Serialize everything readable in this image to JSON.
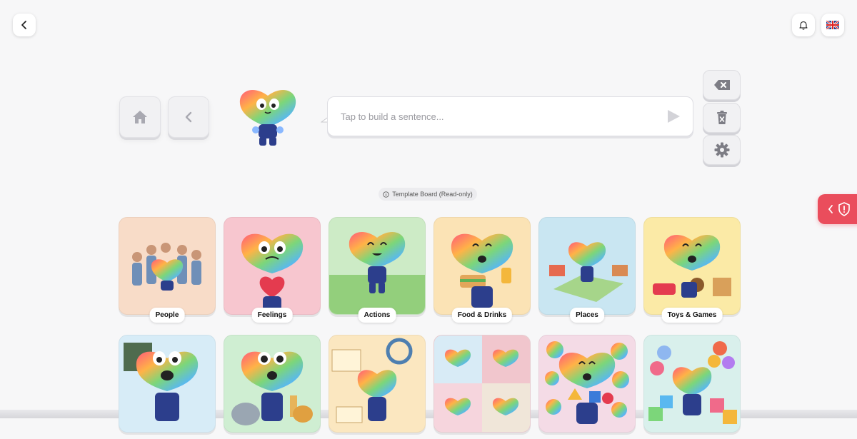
{
  "header": {
    "back_icon": "chevron-left-icon",
    "notifications_icon": "bell-icon",
    "language_icon": "uk-flag-icon"
  },
  "nav": {
    "home_icon": "home-icon",
    "back_icon": "chevron-left-icon"
  },
  "sentence": {
    "placeholder": "Tap to build a sentence...",
    "play_icon": "play-icon"
  },
  "side_controls": {
    "backspace_icon": "backspace-icon",
    "clear_icon": "trash-x-icon",
    "settings_icon": "gear-icon"
  },
  "board": {
    "badge_text": "Template Board (Read-only)",
    "badge_icon": "info-icon"
  },
  "safety_tab": {
    "icon_chevron": "chevron-left-icon",
    "icon_shield": "shield-alert-icon",
    "color": "#ea4d5c"
  },
  "tiles_row1": [
    {
      "label": "People",
      "bg": "#f8dcc8"
    },
    {
      "label": "Feelings",
      "bg": "#f7c6cf"
    },
    {
      "label": "Actions",
      "bg": "#cdebc6"
    },
    {
      "label": "Food & Drinks",
      "bg": "#fbe3b5"
    },
    {
      "label": "Places",
      "bg": "#c9e6f2"
    },
    {
      "label": "Toys & Games",
      "bg": "#fbeaa6"
    }
  ],
  "tiles_row2": [
    {
      "bg": "#d7ecf7"
    },
    {
      "bg": "#cfeed2"
    },
    {
      "bg": "#fbe7c0"
    },
    {
      "bg": "#f3d7dc"
    },
    {
      "bg": "#f4dbe6"
    },
    {
      "bg": "#d9f0ec"
    }
  ]
}
